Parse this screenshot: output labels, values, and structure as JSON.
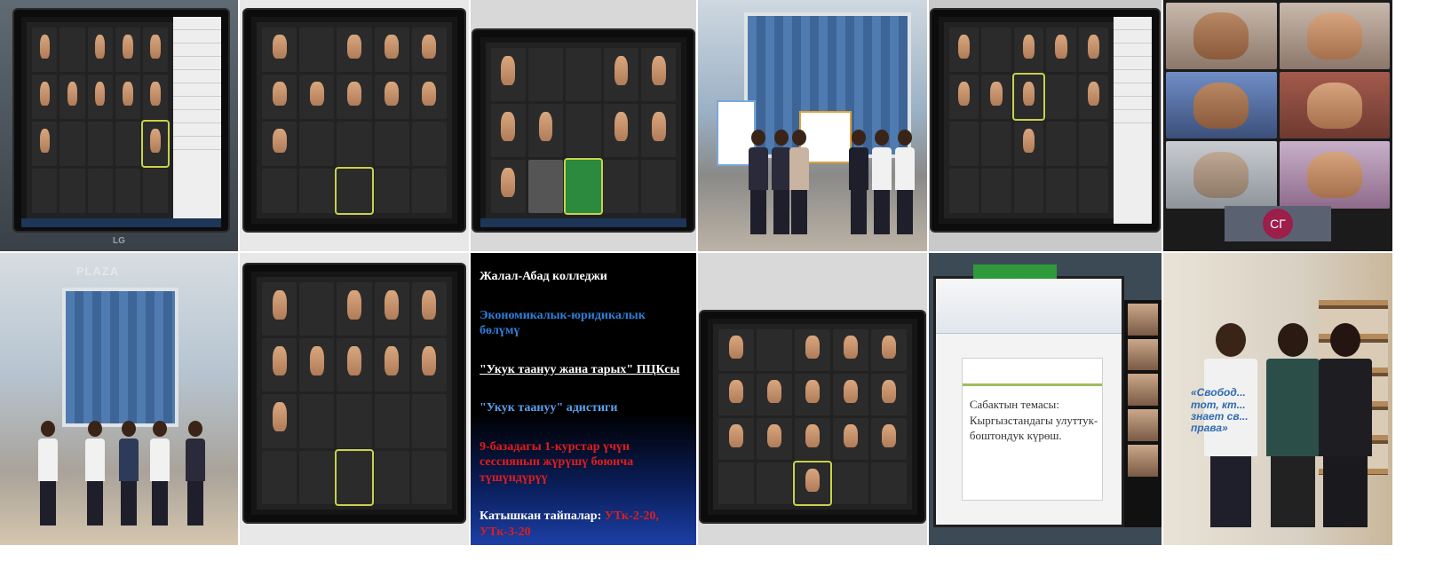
{
  "collage": {
    "tiles": [
      {
        "name": "zoom-meeting-monitor-1"
      },
      {
        "name": "zoom-meeting-monitor-2"
      },
      {
        "name": "zoom-meeting-monitor-3"
      },
      {
        "name": "outdoor-group-posters"
      },
      {
        "name": "zoom-meeting-monitor-4"
      },
      {
        "name": "video-call-grid"
      },
      {
        "name": "outdoor-plaza-group"
      },
      {
        "name": "zoom-meeting-monitor-5"
      },
      {
        "name": "presentation-slide"
      },
      {
        "name": "zoom-meeting-monitor-6"
      },
      {
        "name": "powerpoint-lesson-screen"
      },
      {
        "name": "indoor-three-people"
      }
    ]
  },
  "monitor_brand": "LG",
  "outdoor_plaza_sign": "PLAZA",
  "video_grid_badge": "СГ",
  "slide": {
    "line1": "Жалал-Абад колледжи",
    "line2": "Экономикалык-юридикалык бөлүмү",
    "line3": "\"Укук таануу жана тарых\" ПЦКсы",
    "line4": "\"Укук таануу\" адистиги",
    "line5": "9-базадагы 1-курстар үчүн сессиянын жүрүшү боюнча түшүндүрүү",
    "line6_prefix": "Катышкан тайпалар: ",
    "line6_groups": "УТк-2-20, УТк-3-20"
  },
  "lesson_slide": {
    "text": "Сабактын темасы: Кыргызстандагы улуттук-боштондук күрөш."
  },
  "shirt_text": "«Свобод... тот, кт... знает св... права»"
}
